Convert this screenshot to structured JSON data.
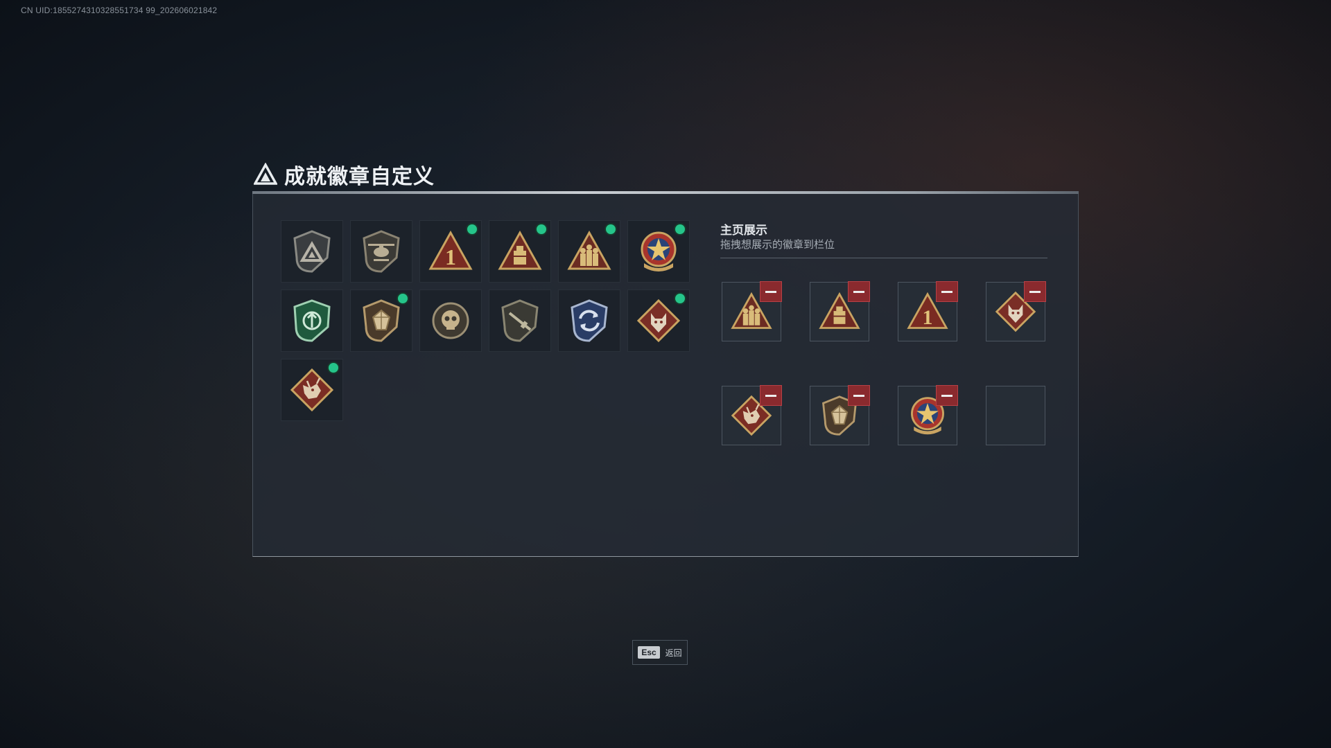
{
  "uid_text": "CN UID:1855274310328551734 99_202606021842",
  "title": "成就徽章自定义",
  "colors": {
    "accent_green": "#25c58a",
    "remove_red": "#8a2a2e",
    "panel_bg": "#242b35"
  },
  "badges": [
    {
      "icon": "shield-triangle-icon",
      "new": false
    },
    {
      "icon": "helicopter-shield-icon",
      "new": false
    },
    {
      "icon": "triangle-number-1-icon",
      "new": true
    },
    {
      "icon": "triangle-box-icon",
      "new": true
    },
    {
      "icon": "triangle-soldiers-icon",
      "new": true
    },
    {
      "icon": "star-medal-icon",
      "new": true
    },
    {
      "icon": "green-shield-icon",
      "new": false
    },
    {
      "icon": "gem-shield-icon",
      "new": true
    },
    {
      "icon": "skull-emblem-icon",
      "new": false
    },
    {
      "icon": "rifle-shield-icon",
      "new": false
    },
    {
      "icon": "blue-arrows-shield-icon",
      "new": false
    },
    {
      "icon": "wolf-diamond-icon",
      "new": true
    },
    {
      "icon": "dragon-diamond-icon",
      "new": true
    }
  ],
  "showcase": {
    "title": "主页展示",
    "subtitle": "拖拽想展示的徽章到栏位",
    "slots": [
      {
        "icon": "triangle-soldiers-icon",
        "filled": true
      },
      {
        "icon": "triangle-box-icon",
        "filled": true
      },
      {
        "icon": "triangle-number-1-icon",
        "filled": true
      },
      {
        "icon": "wolf-diamond-icon",
        "filled": true
      },
      {
        "icon": "dragon-diamond-icon",
        "filled": true
      },
      {
        "icon": "gem-shield-icon",
        "filled": true
      },
      {
        "icon": "star-medal-icon",
        "filled": true
      },
      {
        "icon": "",
        "filled": false
      }
    ]
  },
  "footer": {
    "esc_key": "Esc",
    "esc_label": "返回"
  }
}
